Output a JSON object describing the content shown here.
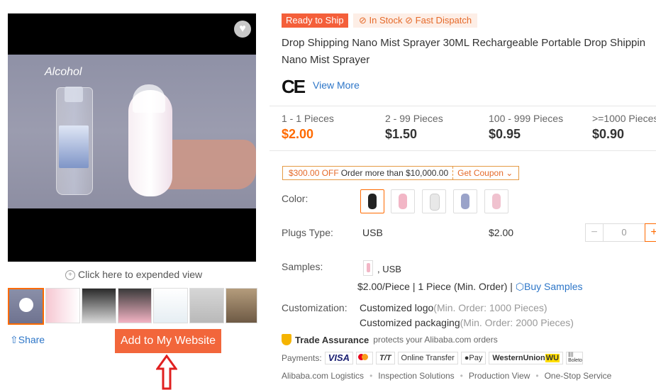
{
  "media": {
    "video_text": "Alcohol",
    "zoom_hint": "Click here to expended view",
    "share_label": "Share",
    "add_button_label": "Add to My Website",
    "thumb_count": 7
  },
  "badges": {
    "ready": "Ready to Ship",
    "stock": "In Stock",
    "dispatch": "Fast Dispatch"
  },
  "product": {
    "title_line1": "Drop Shipping Nano Mist Sprayer 30ML Rechargeable Portable Drop Shippin",
    "title_line2": "Nano Mist Sprayer",
    "cert": "CE",
    "view_more": "View More"
  },
  "tiers": [
    {
      "range": "1 - 1 Pieces",
      "price": "$2.00"
    },
    {
      "range": "2 - 99 Pieces",
      "price": "$1.50"
    },
    {
      "range": "100 - 999 Pieces",
      "price": "$0.95"
    },
    {
      "range": ">=1000 Pieces",
      "price": "$0.90"
    }
  ],
  "coupon": {
    "amount": "$300.00 OFF",
    "condition": "Order more than $10,000.00",
    "get": "Get Coupon"
  },
  "color": {
    "label": "Color:",
    "swatch_colors": [
      "#222222",
      "#f2b6c6",
      "#e8e8e8",
      "#9aa3c9",
      "#f0c2cf"
    ]
  },
  "plugs": {
    "label": "Plugs Type:",
    "value": "USB",
    "price": "$2.00",
    "qty": "0"
  },
  "samples": {
    "label": "Samples:",
    "value": ", USB",
    "price_info": "$2.00/Piece | 1 Piece (Min. Order) |",
    "buy": "Buy Samples"
  },
  "customization": {
    "label": "Customization:",
    "logo": "Customized logo",
    "logo_min": "(Min. Order: 1000 Pieces)",
    "packaging": "Customized packaging",
    "packaging_min": "(Min. Order: 2000 Pieces)"
  },
  "trade": {
    "title": "Trade Assurance",
    "desc": "protects your Alibaba.com orders"
  },
  "payments": {
    "label": "Payments:",
    "methods": [
      "VISA",
      "T/T",
      "Online Transfer",
      "Pay",
      "WesternUnion",
      "WU",
      "Boleto"
    ]
  },
  "footer": [
    "Alibaba.com Logistics",
    "Inspection Solutions",
    "Production View",
    "One-Stop Service"
  ]
}
